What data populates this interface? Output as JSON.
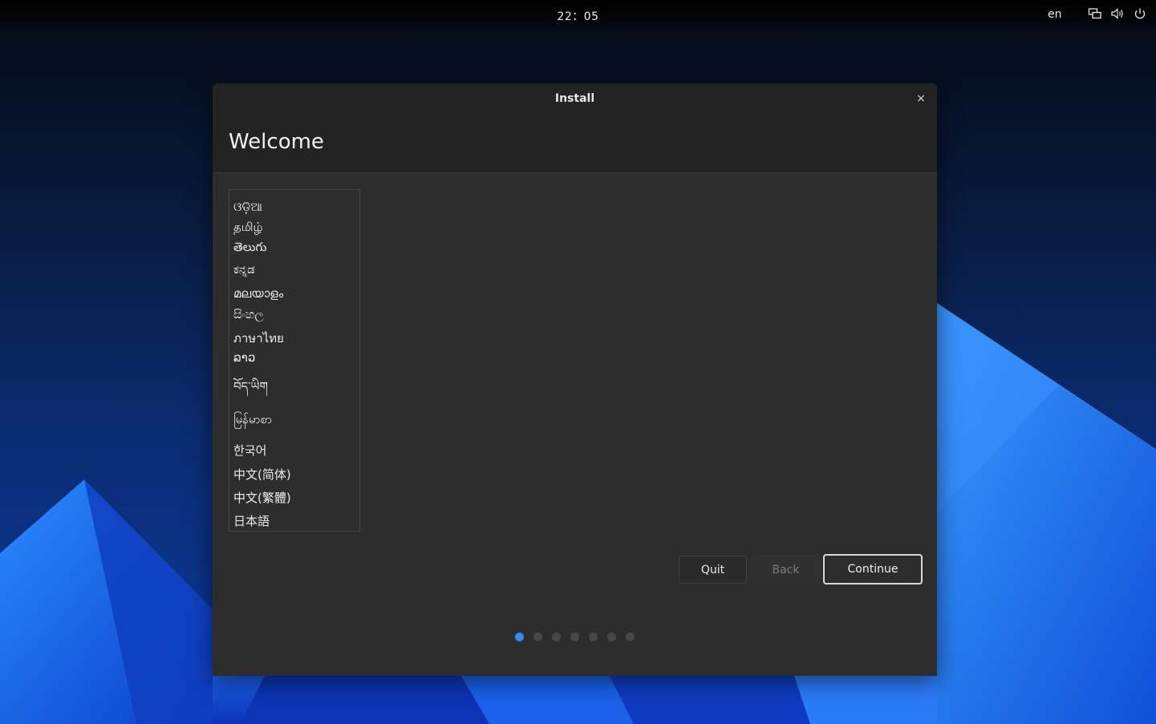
{
  "topbar": {
    "clock": "22：05",
    "language_indicator": "en",
    "icons": [
      "network-icon",
      "volume-icon",
      "power-icon"
    ]
  },
  "window": {
    "title": "Install",
    "close_glyph": "×",
    "heading": "Welcome"
  },
  "languages": {
    "partial_top": "ଓ",
    "items": [
      "ଓଡ଼ିଆ",
      "தமிழ்",
      "తెలుగు",
      "ಕನ್ನಡ",
      "മലയാളം",
      "සිංහල",
      "ภาษาไทย",
      "ລາວ",
      "བོད་ཡིག",
      "မြန်မာစာ",
      "한국어",
      "中文(简体)",
      "中文(繁體)",
      "日本語"
    ]
  },
  "buttons": {
    "quit": "Quit",
    "back": "Back",
    "continue": "Continue"
  },
  "pagination": {
    "total": 7,
    "active": 1
  },
  "colors": {
    "accent": "#3d87e8",
    "window_bg": "#2d2d2d",
    "titlebar_bg": "#232323"
  }
}
